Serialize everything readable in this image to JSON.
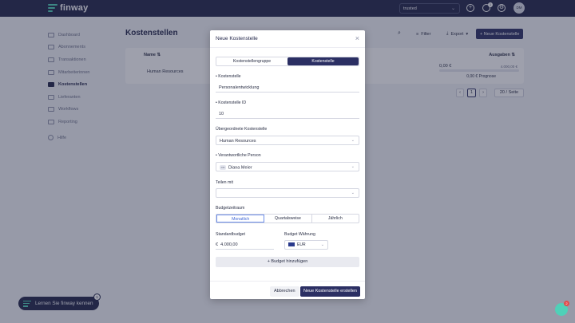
{
  "app": {
    "brand": "finway",
    "tenant": "trusted",
    "user_initials": "DM",
    "notifications": "1"
  },
  "sidebar": {
    "items": [
      {
        "label": "Dashboard"
      },
      {
        "label": "Abonnements"
      },
      {
        "label": "Transaktionen"
      },
      {
        "label": "Mitarbeiterinnen"
      },
      {
        "label": "Kostenstellen"
      },
      {
        "label": "Lieferanten"
      },
      {
        "label": "Workflows"
      },
      {
        "label": "Reporting"
      },
      {
        "label": "Hilfe"
      }
    ],
    "active": "Kostenstellen"
  },
  "page": {
    "title": "Kostenstellen",
    "filter_label": "Filter",
    "export_label": "Export",
    "new_label": "+ Neue Kostenstelle",
    "table": {
      "col_name": "Name",
      "col_expenses": "Ausgaben",
      "rows": [
        {
          "name": "Human Resources",
          "amount": "0,00 €",
          "budget": "4.000,00 €",
          "forecast": "0,00 € Prognose",
          "progress": 0
        }
      ]
    },
    "pagination": {
      "current": "1",
      "page_size": "20 / Seite"
    }
  },
  "modal": {
    "title": "Neue Kostenstelle",
    "tabs": [
      "Kostenstellengruppe",
      "Kostenstelle"
    ],
    "active_tab": "Kostenstelle",
    "name_label": "• Kostenstelle",
    "name_value": "Personalentwicklung",
    "id_label": "• Kostenstelle ID",
    "id_value": "10",
    "parent_label": "Übergeordnete Kostenstelle",
    "parent_value": "Human Resources",
    "owner_label": "• Verantwortliche Person",
    "owner_initials": "DM",
    "owner_value": "Diana Meier",
    "share_label": "Teilen mit",
    "period_label": "Budgetzeitraum",
    "periods": [
      "Monatlich",
      "Quartalsweise",
      "Jährlich"
    ],
    "active_period": "Monatlich",
    "budget_label": "Standardbudget",
    "budget_currency_symbol": "€",
    "budget_value": "4.000,00",
    "currency_label": "Budget Währung",
    "currency_value": "EUR",
    "add_budget_label": "+ Budget hinzufügen",
    "cancel_label": "Abbrechen",
    "submit_label": "Neue Kostenstelle erstellen"
  },
  "learn": {
    "label": "Lernen Sie finway kennen",
    "badge": "1"
  },
  "chat": {
    "badge": "2"
  }
}
